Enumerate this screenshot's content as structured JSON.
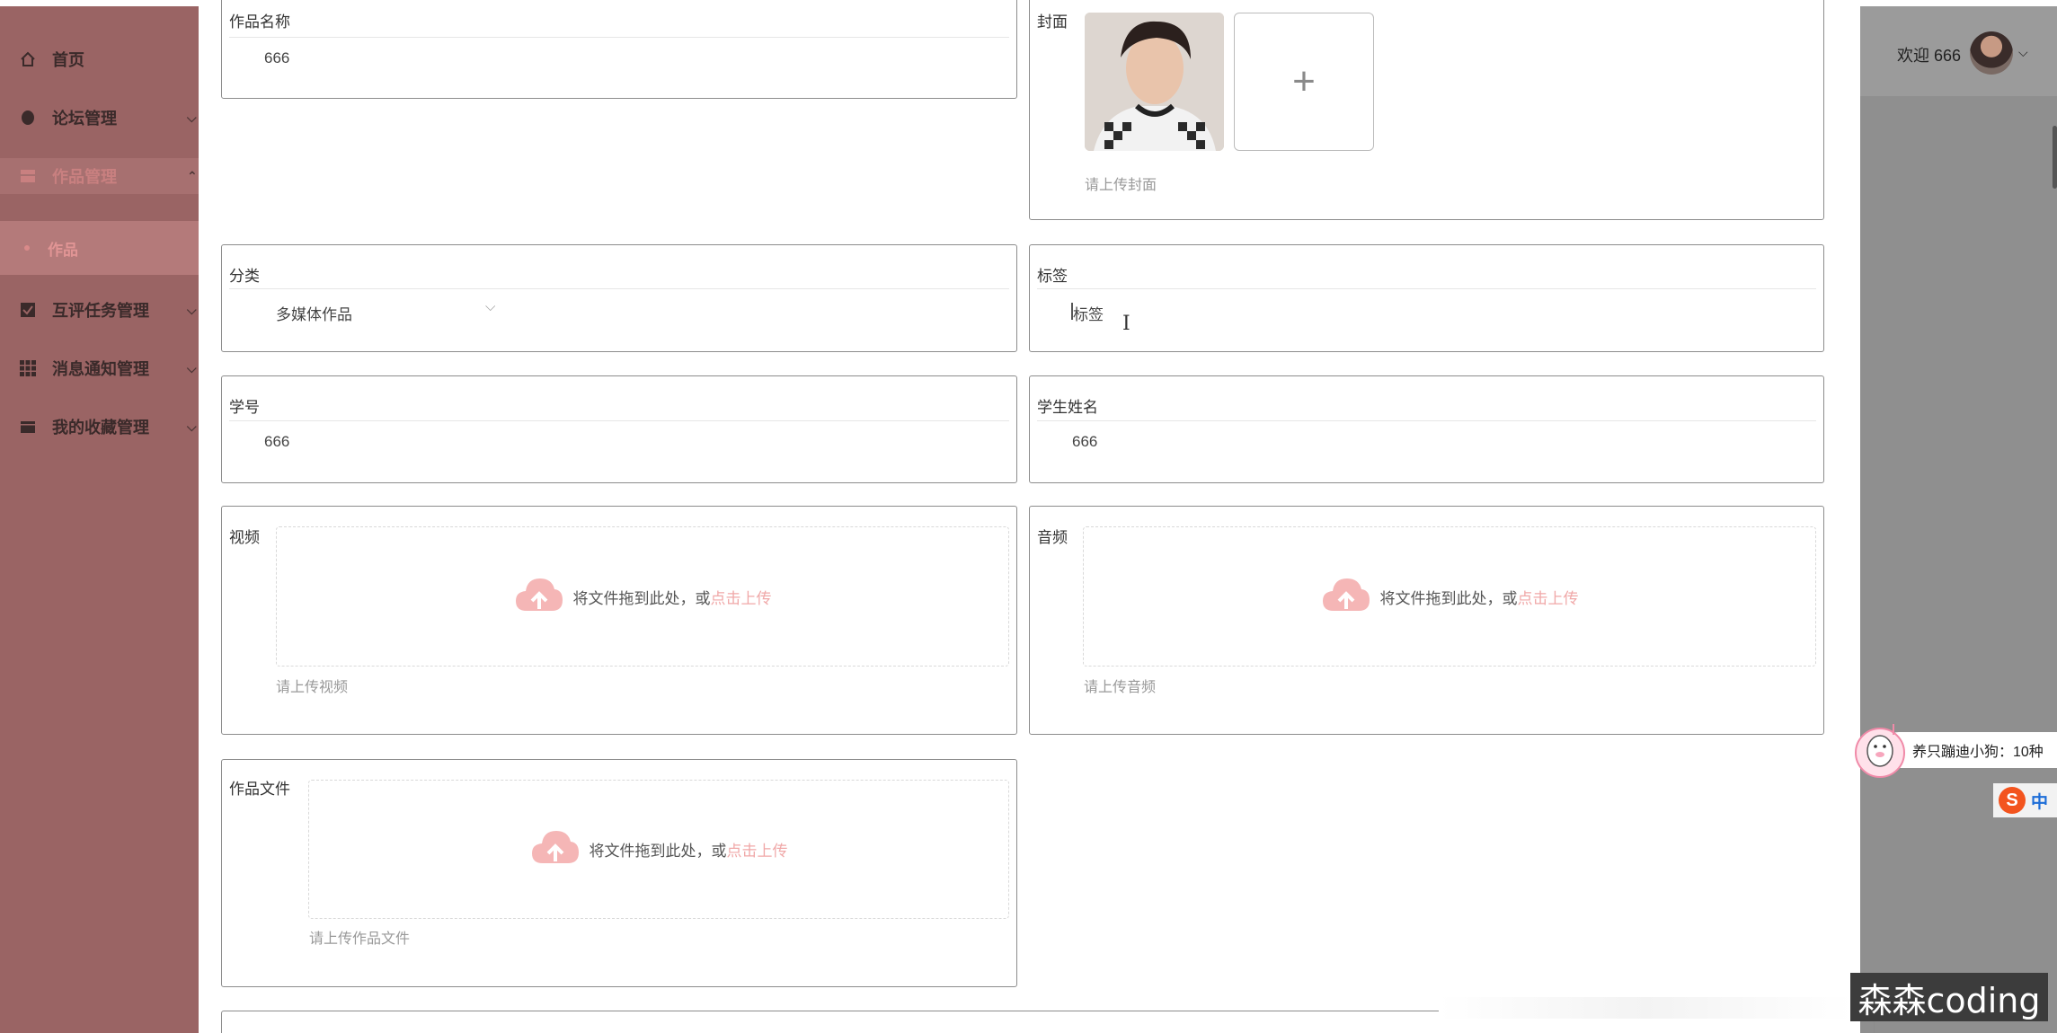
{
  "sidebar": {
    "items": [
      {
        "label": "首页"
      },
      {
        "label": "论坛管理"
      },
      {
        "label": "作品管理"
      },
      {
        "label": "互评任务管理"
      },
      {
        "label": "消息通知管理"
      },
      {
        "label": "我的收藏管理"
      }
    ],
    "sub_item": "作品"
  },
  "header": {
    "welcome": "欢迎 666"
  },
  "form": {
    "work_name": {
      "label": "作品名称",
      "value": "666"
    },
    "cover": {
      "label": "封面",
      "hint": "请上传封面",
      "add_symbol": "+"
    },
    "category": {
      "label": "分类",
      "value": "多媒体作品"
    },
    "tags": {
      "label": "标签",
      "placeholder": "标签"
    },
    "student_id": {
      "label": "学号",
      "value": "666"
    },
    "student_name": {
      "label": "学生姓名",
      "value": "666"
    },
    "video": {
      "label": "视频",
      "drop_text": "将文件拖到此处，或",
      "link_text": "点击上传",
      "hint": "请上传视频"
    },
    "audio": {
      "label": "音频",
      "drop_text": "将文件拖到此处，或",
      "link_text": "点击上传",
      "hint": "请上传音频"
    },
    "work_file": {
      "label": "作品文件",
      "drop_text": "将文件拖到此处，或",
      "link_text": "点击上传",
      "hint": "请上传作品文件"
    }
  },
  "overlay": {
    "notice_text": "养只蹦迪小狗：10种",
    "ime_logo": "S",
    "ime_mode": "中",
    "watermark": "森森coding"
  },
  "colors": {
    "sidebar": "#9a6464",
    "accent_pink": "#f0a8a8",
    "overlay_gray": "#8f8f8f"
  }
}
